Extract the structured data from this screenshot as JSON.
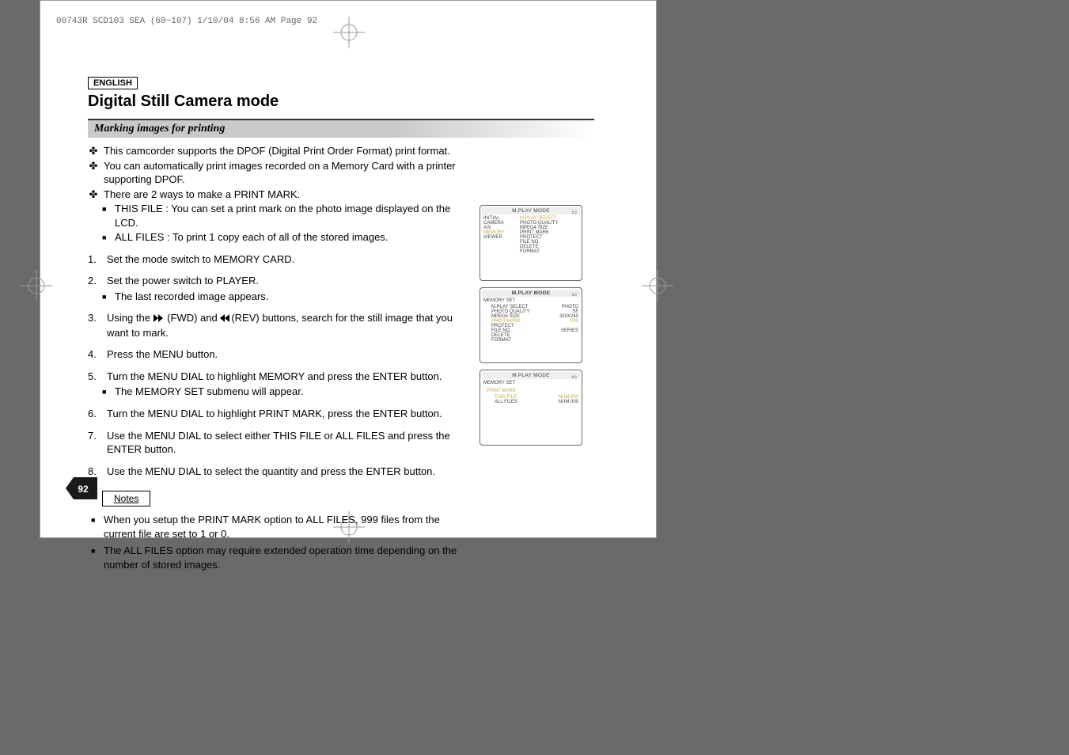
{
  "header_strip": "00743R SCD103 SEA (60~107)  1/10/04 8:56 AM  Page 92",
  "language_label": "ENGLISH",
  "title": "Digital Still Camera mode",
  "subtitle": "Marking images for printing",
  "intro": {
    "b1": "This camcorder supports the DPOF (Digital Print Order Format) print format.",
    "b2": "You can automatically print images recorded on a Memory Card with a printer supporting DPOF.",
    "b3": "There are 2 ways to make a PRINT MARK.",
    "b3a": "THIS FILE : You can set a print mark on the photo image displayed on the LCD.",
    "b3b": "ALL FILES : To print 1 copy each of all of the stored images."
  },
  "steps": {
    "s1": {
      "n": "1.",
      "t": "Set the mode switch to MEMORY CARD."
    },
    "s2": {
      "n": "2.",
      "t": "Set the power switch to PLAYER.",
      "sub": "The last recorded image appears."
    },
    "s3a": {
      "n": "3.",
      "pre": "Using the ",
      "mid": " (FWD) and  ",
      "post": "(REV) buttons, search for the still image that you want to mark."
    },
    "s4": {
      "n": "4.",
      "t": "Press the MENU button."
    },
    "s5": {
      "n": "5.",
      "t": "Turn the MENU DIAL to highlight MEMORY and press the ENTER button.",
      "sub": "The MEMORY SET submenu will appear."
    },
    "s6": {
      "n": "6.",
      "t": "Turn the MENU DIAL to highlight PRINT MARK, press the ENTER button."
    },
    "s7": {
      "n": "7.",
      "t": "Use the MENU DIAL to select either THIS FILE or ALL FILES and press the ENTER button."
    },
    "s8": {
      "n": "8.",
      "t": "Use the MENU DIAL to select the quantity and press the ENTER button."
    }
  },
  "notes_label": "Notes",
  "notes": {
    "n1": "When you setup the PRINT MARK option to ALL FILES, 999 files from the current file are set to 1 or 0.",
    "n2": "The ALL FILES option may require extended operation time depending on the number of stored images."
  },
  "page_number": "92",
  "lcd": {
    "hdr": "M.PLAY  MODE",
    "panel1": {
      "left": [
        "INITIAL",
        "CAMERA",
        "A/V",
        "MEMORY",
        "VIEWER"
      ],
      "right": [
        "M.PLAY SELECT",
        "PHOTO QUALITY",
        "MPEG4 SIZE",
        "PRINT MARK",
        "PROTECT",
        "FILE NO.",
        "DELETE",
        "FORMAT"
      ]
    },
    "panel2": {
      "sub": "MEMORY SET",
      "rows": [
        {
          "l": "M.PLAY SELECT",
          "r": "PHOTO"
        },
        {
          "l": "PHOTO QUALITY",
          "r": "SF"
        },
        {
          "l": "MPEG4 SIZE",
          "r": "320X240"
        },
        {
          "l": "PRINT MARK",
          "r": "000"
        },
        {
          "l": "PROTECT",
          "r": ""
        },
        {
          "l": "FILE NO.",
          "r": "SERIES"
        },
        {
          "l": "DELETE",
          "r": ""
        },
        {
          "l": "FORMAT",
          "r": ""
        }
      ]
    },
    "panel3": {
      "sub": "MEMORY SET",
      "sub2": "PRINT MARK",
      "rows": [
        {
          "l": "THIS FILE",
          "r": "NUM.000"
        },
        {
          "l": "ALL FILES",
          "r": "NUM.000"
        }
      ]
    }
  }
}
